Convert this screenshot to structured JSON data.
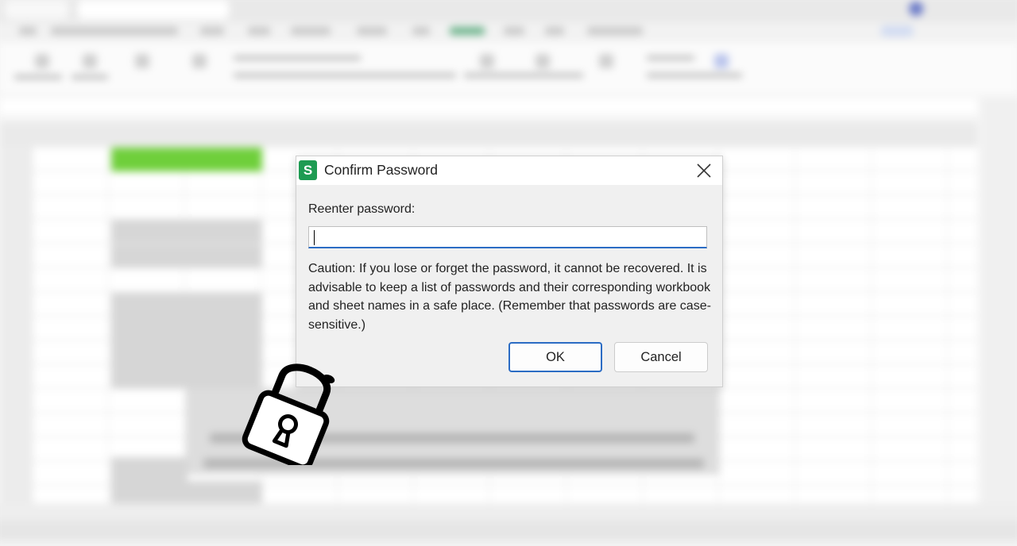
{
  "dialog": {
    "app_icon_letter": "S",
    "title": "Confirm Password",
    "close_icon": "close-icon",
    "label": "Reenter password:",
    "password_value": "",
    "caution_text": "Caution: If you lose or forget the password, it cannot be recovered. It is advisable to keep a list of passwords and their corresponding workbook and sheet names in a safe place. (Remember that passwords are case-sensitive.)",
    "ok_label": "OK",
    "cancel_label": "Cancel"
  },
  "overlay": {
    "icon": "padlock-icon"
  },
  "colors": {
    "app_icon": "#1e9b52",
    "focus_accent": "#2b6cc4",
    "dialog_bg": "#f0f0f0",
    "highlight_cell": "#6fcf3b"
  }
}
